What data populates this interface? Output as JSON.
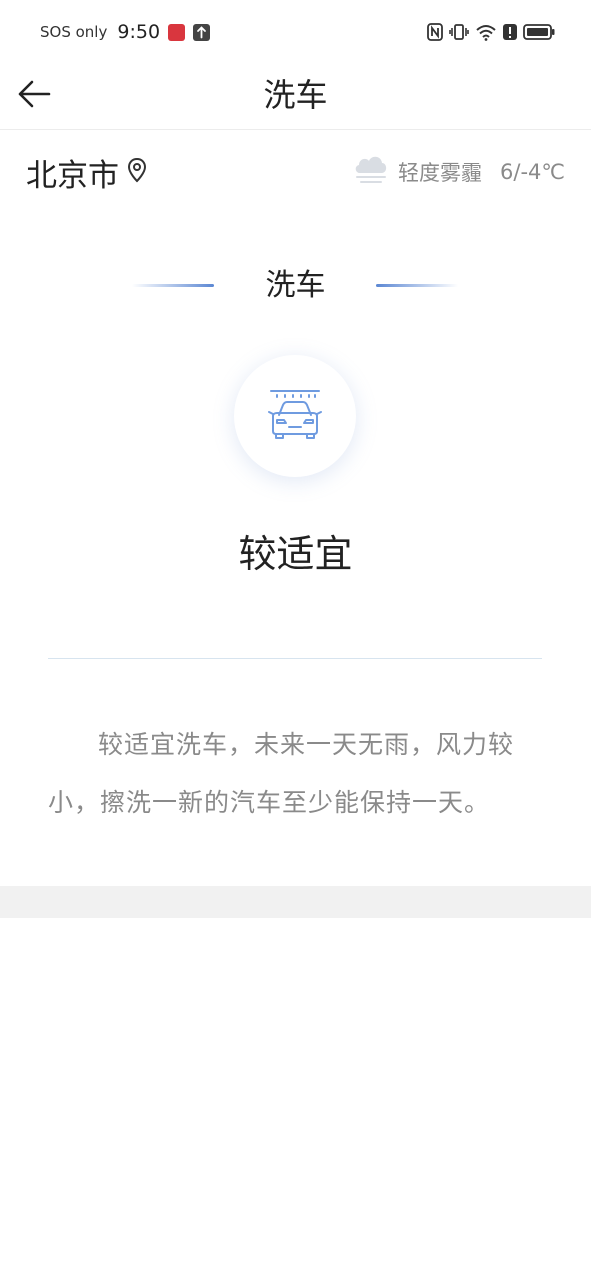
{
  "status_bar": {
    "carrier_text": "SOS only",
    "time": "9:50"
  },
  "header": {
    "title": "洗车",
    "back_icon": "arrow-left-icon"
  },
  "location": {
    "city": "北京市",
    "icon": "location-pin-icon"
  },
  "weather": {
    "icon": "cloud-fog-icon",
    "condition": "轻度雾霾",
    "temperature": "6/-4℃"
  },
  "index": {
    "section_title": "洗车",
    "icon": "car-wash-icon",
    "level": "较适宜",
    "description": "较适宜洗车，未来一天无雨，风力较小，擦洗一新的汽车至少能保持一天。"
  },
  "colors": {
    "accent": "#5b87d3",
    "icon_blue": "#6f9be0",
    "text_primary": "#222222",
    "text_secondary": "#8a8a8a",
    "divider": "#d7e4ef",
    "band": "#f1f1f1"
  }
}
